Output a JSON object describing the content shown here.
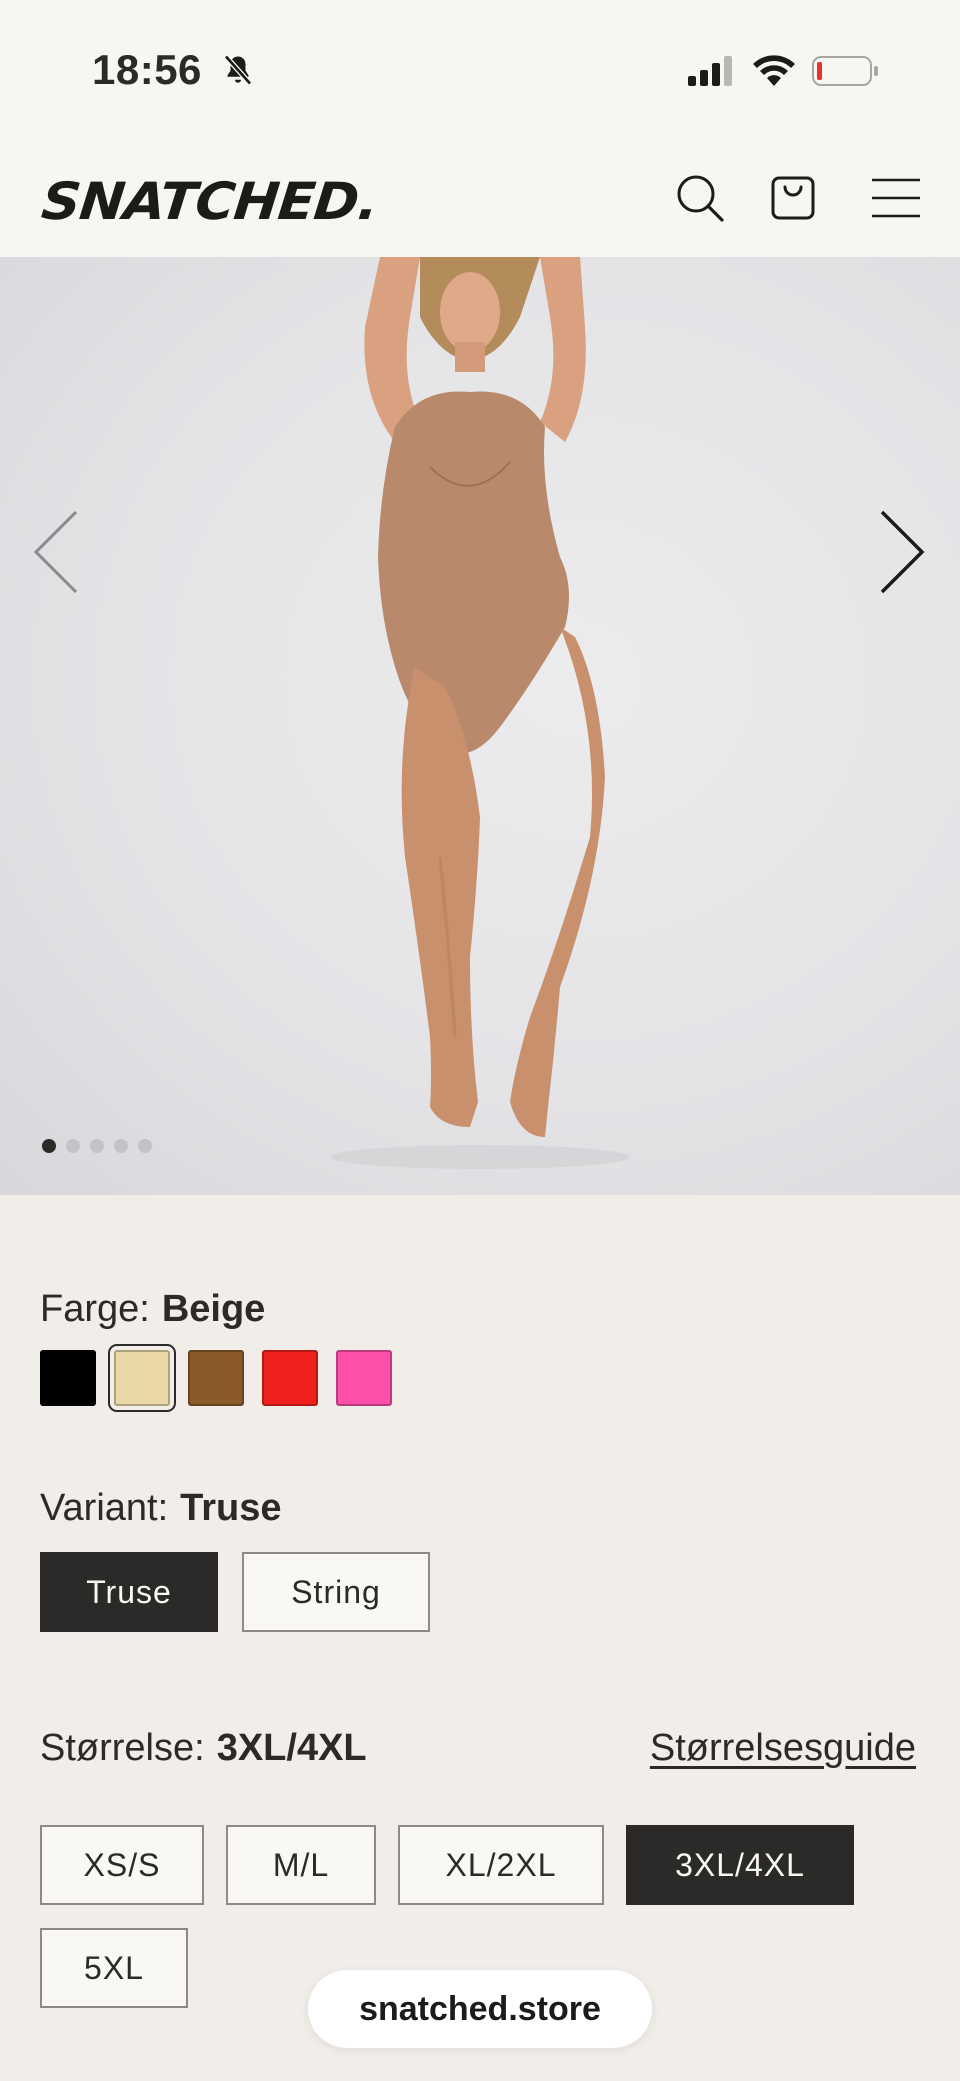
{
  "status_bar": {
    "time": "18:56",
    "icons": [
      "bell-off-icon",
      "signal-icon",
      "wifi-icon",
      "battery-icon"
    ]
  },
  "header": {
    "logo": "SNATCHED.",
    "icons": [
      "search-icon",
      "cart-icon",
      "menu-icon"
    ]
  },
  "gallery": {
    "image": "model-in-bodysuit-photo",
    "slides": 5,
    "active_slide": 1
  },
  "color": {
    "label": "Farge:",
    "value": "Beige",
    "swatches": [
      {
        "name": "Black",
        "color": "#000000"
      },
      {
        "name": "Beige",
        "color": "#e9d9a9",
        "selected": true
      },
      {
        "name": "Brown",
        "color": "#8b5a2b"
      },
      {
        "name": "Red",
        "color": "#f0201d"
      },
      {
        "name": "Pink",
        "color": "#fb4fa8"
      }
    ]
  },
  "variant": {
    "label": "Variant:",
    "value": "Truse",
    "options": [
      "Truse",
      "String"
    ],
    "selected": "Truse"
  },
  "size": {
    "label": "Størrelse:",
    "value": "3XL/4XL",
    "guide": "Størrelsesguide",
    "options": [
      "XS/S",
      "M/L",
      "XL/2XL",
      "3XL/4XL",
      "5XL"
    ],
    "selected": "3XL/4XL"
  },
  "browser": {
    "url": "snatched.store"
  },
  "colors": {
    "background": "#f1eee9",
    "header": "#f8f6f2",
    "accent_dark": "#2b2a28"
  }
}
